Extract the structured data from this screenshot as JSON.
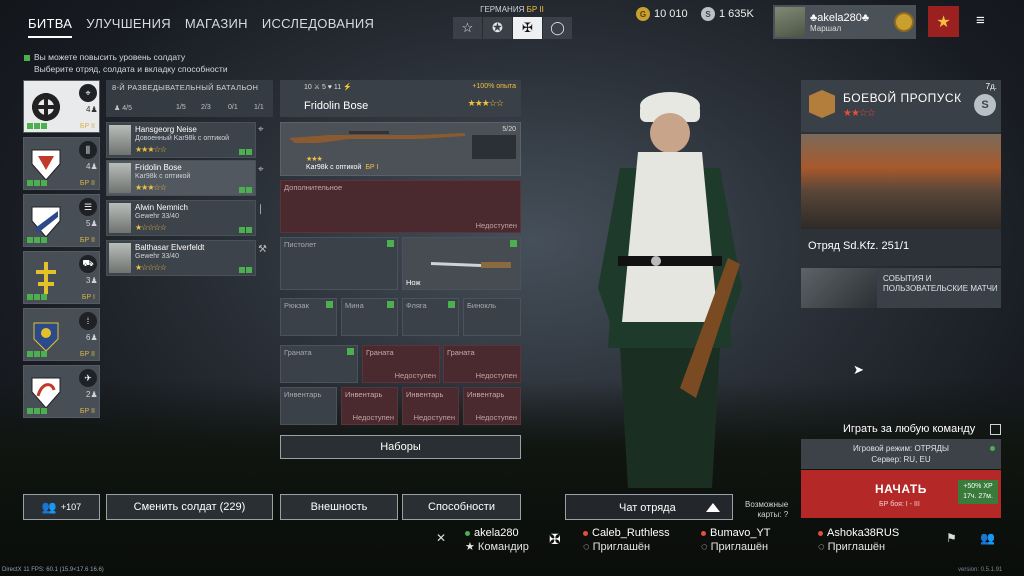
{
  "nav": {
    "tabs": [
      "БИТВА",
      "УЛУЧШЕНИЯ",
      "МАГАЗИН",
      "ИССЛЕДОВАНИЯ"
    ]
  },
  "hint": {
    "line1": "Вы можете повысить уровень солдату",
    "line2": "Выберите отряд, солдата и вкладку способности"
  },
  "nation": {
    "name": "ГЕРМАНИЯ",
    "br": "БР II"
  },
  "currency": {
    "gold": "10 010",
    "silver": "1 635K"
  },
  "user": {
    "name": "akela280",
    "rank": "Маршал"
  },
  "squads": [
    {
      "count": "4",
      "br": "БР II"
    },
    {
      "count": "4",
      "br": "БР II"
    },
    {
      "count": "5",
      "br": "БР II"
    },
    {
      "count": "3",
      "br": "БР I"
    },
    {
      "count": "6",
      "br": "БР II"
    },
    {
      "count": "2",
      "br": "БР II"
    }
  ],
  "battalion": {
    "title": "8-Й РАЗВЕДЫВАТЕЛЬНЫЙ БАТАЛЬОН",
    "count": "4/5",
    "slots": [
      "1/5",
      "2/3",
      "0/1",
      "1/1"
    ]
  },
  "soldiers": [
    {
      "name": "Hansgeorg Neise",
      "weapon": "Довоенный Kar98k с оптикой",
      "stars": "★★★☆☆"
    },
    {
      "name": "Fridolin Bose",
      "weapon": "Kar98k с оптикой",
      "stars": "★★★☆☆"
    },
    {
      "name": "Alwin Nemnich",
      "weapon": "Gewehr 33/40",
      "stars": "★☆☆☆☆"
    },
    {
      "name": "Balthasar Elverfeldt",
      "weapon": "Gewehr 33/40",
      "stars": "★☆☆☆☆"
    }
  ],
  "loadout": {
    "stats": "10 ⚔ 5 ♥ 11 ⚡",
    "exp_bonus": "+100% опыта",
    "soldier_name": "Fridolin Bose",
    "soldier_stars": "★★★☆☆",
    "primary": {
      "name": "Kar98k с оптикой",
      "br": "БР I",
      "ammo": "5/20",
      "stars": "★★★"
    },
    "additional": {
      "label": "Дополнительное",
      "status": "Недоступен"
    },
    "pistol": "Пистолет",
    "knife": "Нож",
    "small": [
      "Рюкзак",
      "Мина",
      "Фляга",
      "Бинокль"
    ],
    "grenades": [
      {
        "label": "Граната",
        "status": ""
      },
      {
        "label": "Граната",
        "status": "Недоступен"
      },
      {
        "label": "Граната",
        "status": "Недоступен"
      }
    ],
    "inventory": [
      {
        "label": "Инвентарь",
        "status": ""
      },
      {
        "label": "Инвентарь",
        "status": "Недоступен"
      },
      {
        "label": "Инвентарь",
        "status": "Недоступен"
      },
      {
        "label": "Инвентарь",
        "status": "Недоступен"
      }
    ],
    "kits": "Наборы"
  },
  "bottom": {
    "friends": "+107",
    "change": "Сменить солдат (229)",
    "appearance": "Внешность",
    "abilities": "Способности",
    "chat": "Чат отряда",
    "maps1": "Возможные",
    "maps2": "карты:"
  },
  "battlepass": {
    "title": "БОЕВОЙ ПРОПУСК",
    "stars": "★★☆☆",
    "days": "7д.",
    "reward": "Отряд Sd.Kfz. 251/1"
  },
  "events": {
    "text": "СОБЫТИЯ И ПОЛЬЗОВАТЕЛЬСКИЕ МАТЧИ"
  },
  "play": {
    "any_team": "Играть за любую команду",
    "mode": "Игровой режим: ОТРЯДЫ",
    "server": "Сервер: RU, EU",
    "start": "НАЧАТЬ",
    "br": "БР боя: I - III",
    "bonus1": "+50% XP",
    "bonus2": "17ч. 27м."
  },
  "party": [
    {
      "name": "akela280",
      "sub": "Командир",
      "color": "#4caf50"
    },
    {
      "name": "Caleb_Ruthless",
      "sub": "Приглашён",
      "color": "#e74c3c"
    },
    {
      "name": "Bumavo_YT",
      "sub": "Приглашён",
      "color": "#e74c3c"
    },
    {
      "name": "Ashoka38RUS",
      "sub": "Приглашён",
      "color": "#e74c3c"
    }
  ],
  "footer": {
    "fps": "DirectX 11 FPS: 60.1 (15.9<17.6 16.6)",
    "version": "version: 0.5.1.91"
  }
}
